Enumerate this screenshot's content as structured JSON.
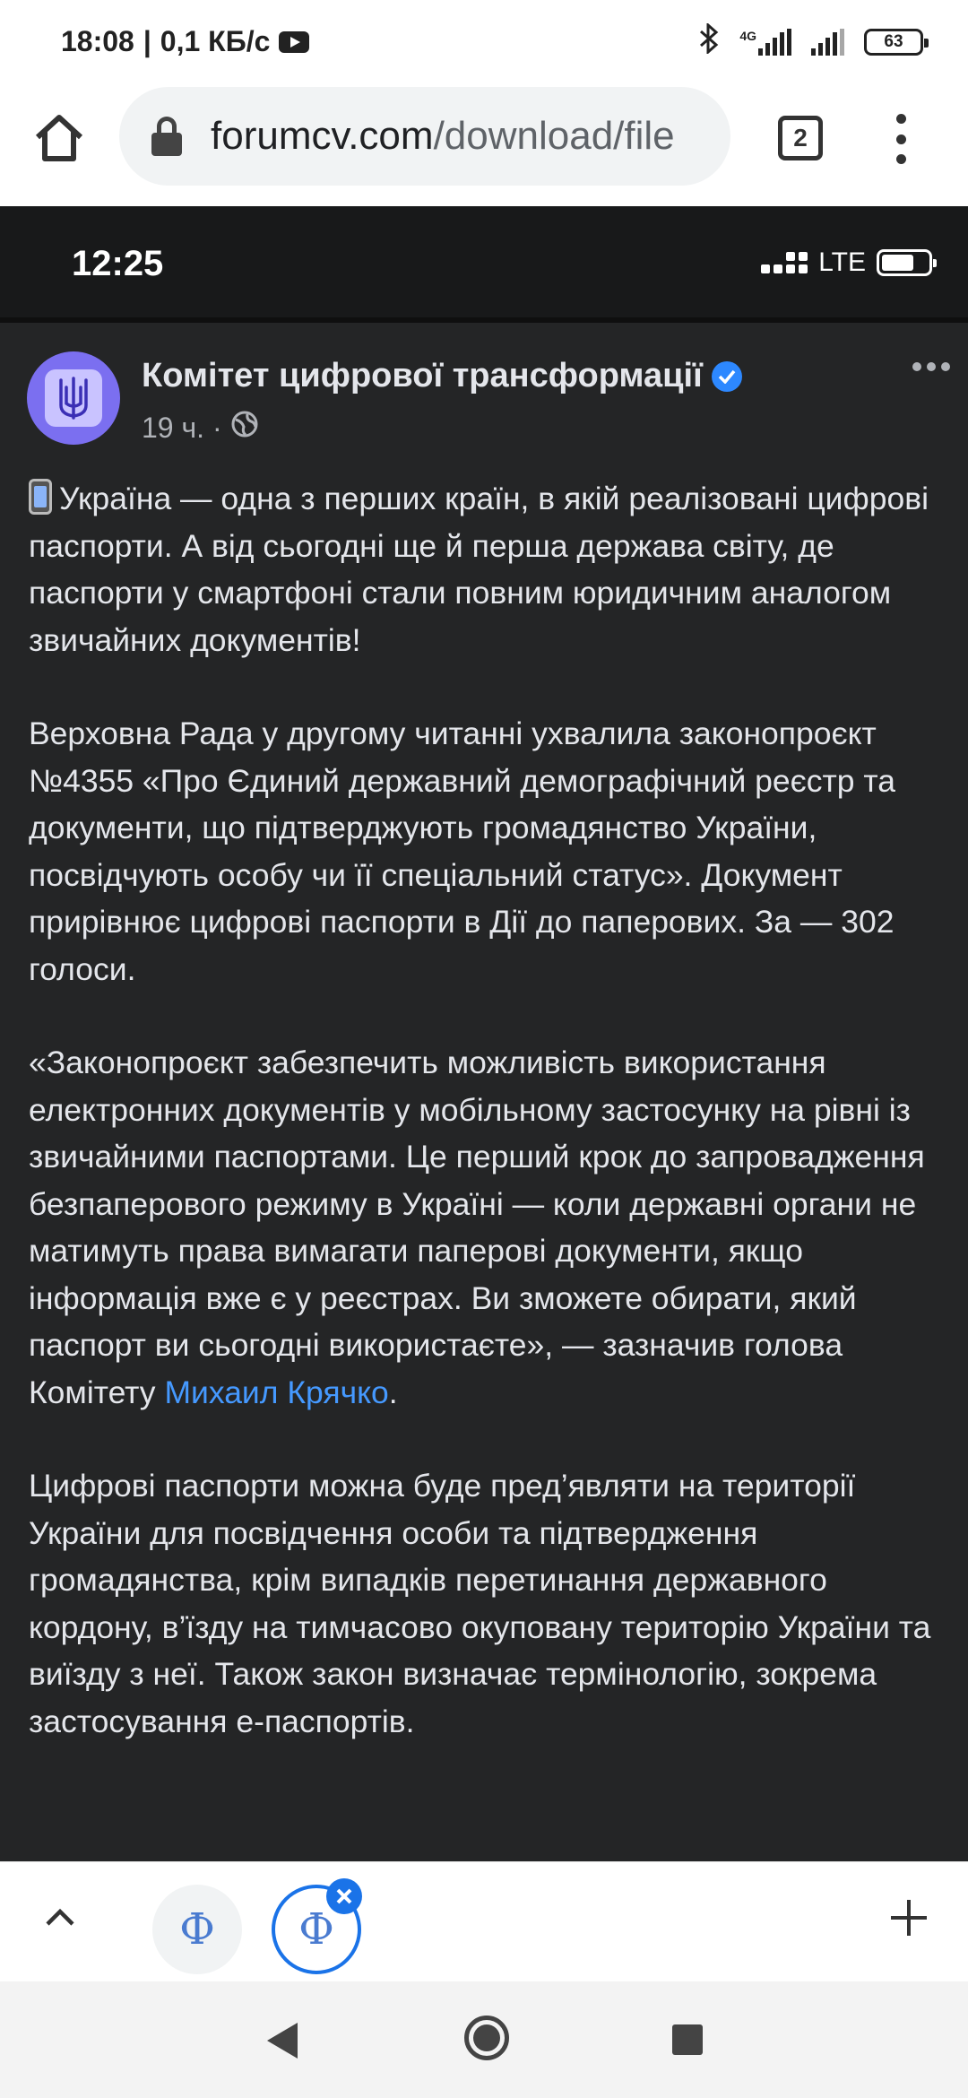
{
  "status_bar": {
    "time": "18:08",
    "speed": "0,1 КБ/с",
    "network": "4G",
    "battery": "63"
  },
  "browser": {
    "url_domain": "forumcv.com",
    "url_path": "/download/file",
    "tab_count": "2",
    "accent_color": "#1a73e8"
  },
  "inner_status": {
    "time": "12:25",
    "network": "LTE"
  },
  "post": {
    "page_name": "Комітет цифрової трансформації",
    "time_ago": "19 ч. ·",
    "paragraphs": [
      "Україна — одна з перших країн, в якій реалізовані цифрові паспорти. А від сьогодні ще й перша держава світу, де паспорти у смартфоні стали повним юридичним аналогом звичайних документів!",
      "Верховна Рада у другому читанні ухвалила законопроєкт №4355 «Про Єдиний державний демографічний реєстр та документи, що підтверджують громадянство України, посвідчують особу чи її спеціальний статус». Документ прирівнює цифрові паспорти в Дії до паперових. За — 302 голоси.",
      "«Законопроєкт забезпечить можливість використання електронних документів у мобільному застосунку на рівні із звичайними паспортами. Це перший крок до запровадження безпаперового режиму в Україні — коли державні органи не матимуть права вимагати паперові документи, якщо інформація вже є у реєстрах. Ви зможете обирати, який паспорт ви сьогодні використаєте», — зазначив голова Комітету",
      "Михаил Крячко",
      ".",
      "Цифрові паспорти можна буде пред’являти на території України для посвідчення особи та підтвердження громадянства, крім випадків перетинання державного кордону, в’їзду на тимчасово окуповану територію України та виїзду з неї. Також закон визначає термінологію, зокрема застосування е-паспортів."
    ],
    "mention_color": "#4599ff"
  },
  "tab_strip": {
    "tab_glyph": "Ф"
  },
  "icons": {
    "home": "home-icon",
    "lock": "lock-icon",
    "menu": "more-vert-icon",
    "verified": "verified-badge-icon",
    "globe": "globe-icon",
    "phone_emoji": "mobile-phone-icon",
    "trident": "trident-icon"
  }
}
